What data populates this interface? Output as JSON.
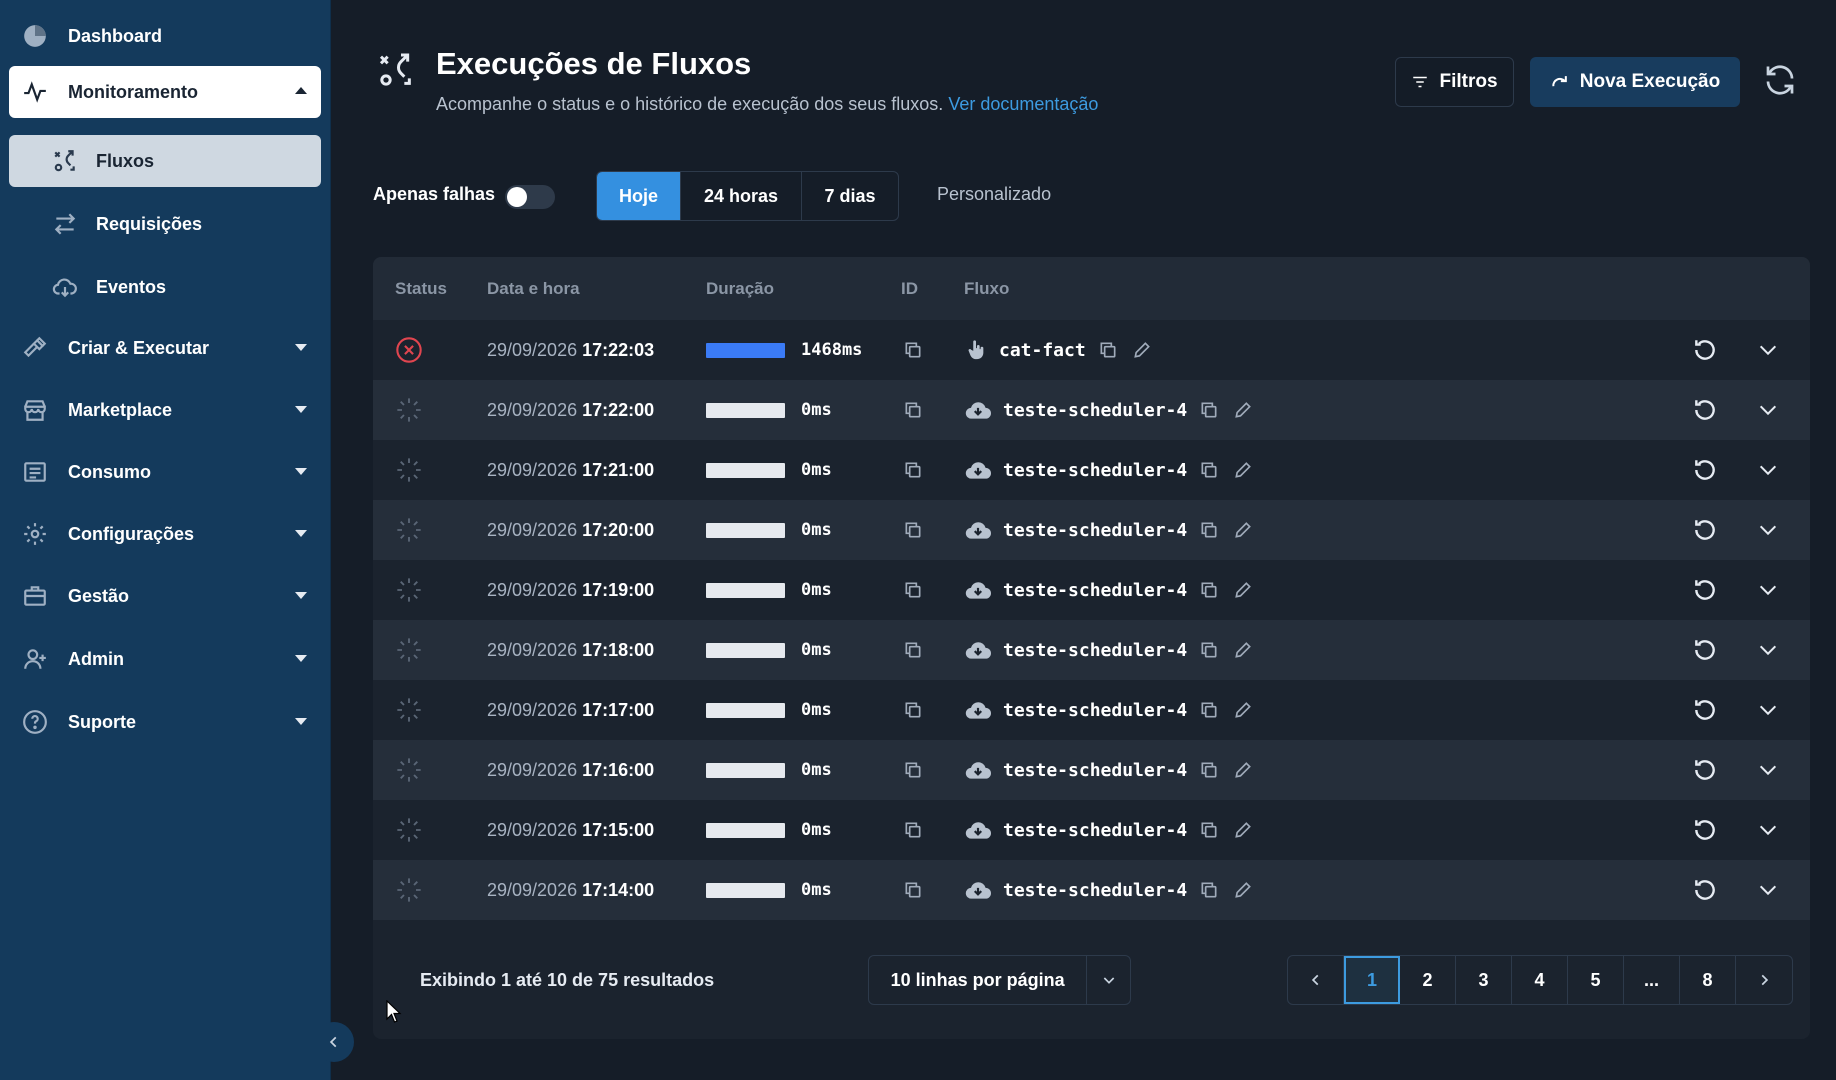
{
  "sidebar": {
    "items": [
      {
        "label": "Dashboard"
      },
      {
        "label": "Monitoramento"
      },
      {
        "label": "Fluxos"
      },
      {
        "label": "Requisições"
      },
      {
        "label": "Eventos"
      },
      {
        "label": "Criar & Executar"
      },
      {
        "label": "Marketplace"
      },
      {
        "label": "Consumo"
      },
      {
        "label": "Configurações"
      },
      {
        "label": "Gestão"
      },
      {
        "label": "Admin"
      },
      {
        "label": "Suporte"
      }
    ]
  },
  "header": {
    "title": "Execuções de Fluxos",
    "subtitle": "Acompanhe o status e o histórico de execução dos seus fluxos.",
    "doc_link": "Ver documentação",
    "filters_label": "Filtros",
    "new_label": "Nova Execução"
  },
  "filters": {
    "only_failures_label": "Apenas falhas",
    "only_failures_on": false,
    "ranges": [
      "Hoje",
      "24 horas",
      "7 dias"
    ],
    "selected_range": "Hoje",
    "custom_label": "Personalizado"
  },
  "table": {
    "headers": {
      "status": "Status",
      "datetime": "Data e hora",
      "duration": "Duração",
      "id": "ID",
      "flow": "Fluxo"
    },
    "rows": [
      {
        "status": "error",
        "date": "29/09/2026",
        "time": "17:22:03",
        "duration": "1468ms",
        "trigger": "hand-icon",
        "flow": "cat-fact",
        "bar": "blue"
      },
      {
        "status": "pending",
        "date": "29/09/2026",
        "time": "17:22:00",
        "duration": "0ms",
        "trigger": "cloud-icon",
        "flow": "teste-scheduler-4",
        "bar": "white"
      },
      {
        "status": "pending",
        "date": "29/09/2026",
        "time": "17:21:00",
        "duration": "0ms",
        "trigger": "cloud-icon",
        "flow": "teste-scheduler-4",
        "bar": "white"
      },
      {
        "status": "pending",
        "date": "29/09/2026",
        "time": "17:20:00",
        "duration": "0ms",
        "trigger": "cloud-icon",
        "flow": "teste-scheduler-4",
        "bar": "white"
      },
      {
        "status": "pending",
        "date": "29/09/2026",
        "time": "17:19:00",
        "duration": "0ms",
        "trigger": "cloud-icon",
        "flow": "teste-scheduler-4",
        "bar": "white"
      },
      {
        "status": "pending",
        "date": "29/09/2026",
        "time": "17:18:00",
        "duration": "0ms",
        "trigger": "cloud-icon",
        "flow": "teste-scheduler-4",
        "bar": "white"
      },
      {
        "status": "pending",
        "date": "29/09/2026",
        "time": "17:17:00",
        "duration": "0ms",
        "trigger": "cloud-icon",
        "flow": "teste-scheduler-4",
        "bar": "white"
      },
      {
        "status": "pending",
        "date": "29/09/2026",
        "time": "17:16:00",
        "duration": "0ms",
        "trigger": "cloud-icon",
        "flow": "teste-scheduler-4",
        "bar": "white"
      },
      {
        "status": "pending",
        "date": "29/09/2026",
        "time": "17:15:00",
        "duration": "0ms",
        "trigger": "cloud-icon",
        "flow": "teste-scheduler-4",
        "bar": "white"
      },
      {
        "status": "pending",
        "date": "29/09/2026",
        "time": "17:14:00",
        "duration": "0ms",
        "trigger": "cloud-icon",
        "flow": "teste-scheduler-4",
        "bar": "white"
      }
    ]
  },
  "footer": {
    "summary": "Exibindo 1 até 10 de 75 resultados",
    "per_page": "10 linhas por página",
    "pages": [
      "1",
      "2",
      "3",
      "4",
      "5",
      "...",
      "8"
    ],
    "current_page": "1"
  },
  "colors": {
    "sidebar_bg": "#143a5c",
    "content_bg": "#151d28",
    "accent": "#3490e0",
    "error": "#e0454f",
    "link": "#3d9be0"
  }
}
